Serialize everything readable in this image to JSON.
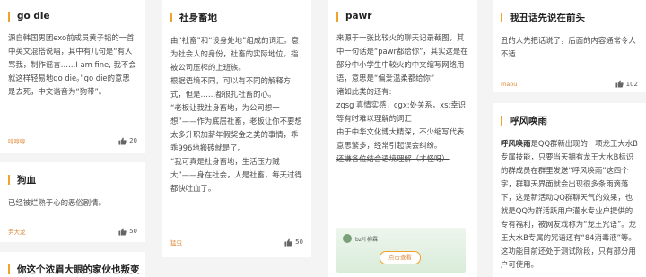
{
  "cards": [
    {
      "title": "go die",
      "paragraphs": [
        "源自韩国男团exo前成员黄子韬的一首中英文混搭说唱，其中有几句是“有人骂我，制作谣言……I am fine, 我不会就这样轻易地go die。”go die的意思是去死，中文谐音为“狗带”。"
      ],
      "author": "哼哼哼",
      "likes": "20"
    },
    {
      "title": "狗血",
      "paragraphs": [
        "已经被烂熟于心的恶俗剧情。"
      ],
      "author": "尹大龙",
      "likes": "50"
    },
    {
      "title": "你这个浓眉大眼的家伙也叛变"
    },
    {
      "title": "社身畜地",
      "paragraphs": [
        "由“社畜”和“设身处地”组成的词汇。意为社会人的身份，社畜的实际地位。指被公司压榨的上班族。",
        "根据语境不同，可以有不同的解释方式，但是……都很扎社畜的心。",
        "“老板让我社身畜地，为公司想一想”——作为底层社畜，老板让你不要想太多升职加薪年假奖金之类的事情，乖乖996地搬砖就是了。",
        "“我可真是社身畜地，生活压力贼大”——身在社会，人是社畜，每天过得都快吐血了。"
      ],
      "author": "猛虫",
      "likes": "50"
    },
    {
      "title": "pawr",
      "paragraphs": [
        "来源于一张比较火的聊天记录截图，其中一句话是“pawr都给你”，其实这是在部分中小学生中较火的中文缩写网络用语，意思是“偏爱温柔都给你”",
        "诸如此类的还有:",
        "zqsg 真情实感，cgx:处关系，xs:幸识",
        "等有时难以理解的词汇",
        "由于中华文化博大精深，不少缩写代表意思繁多，经常引起误会纠纷。"
      ],
      "strike_text": "还嫌各位结合语境理解（才怪呀）",
      "preview_name": "bz叶柳霖",
      "preview_button": "点击查看"
    },
    {
      "title": "我丑话先说在前头",
      "paragraphs": [
        "丑的人先把话说了，后面的内容通常令人不适"
      ],
      "author": "maou",
      "likes": "102"
    },
    {
      "title": "呼风唤雨",
      "lead": "呼风唤雨",
      "paragraphs": [
        "是QQ群新出现的一项龙王大水B专属技能，只要当天拥有龙王大水B标识的群成员在群里发送",
        "“呼风唤雨”这四个字，群聊天界面就会出现很多条雨滴落下，这是新活动QQ群聊天气的效果，也就是QQ为群活跃用户灌水专业户提供的专有福利，被网友戏称为“龙王咒语”。龙王大水B专属的咒语还有“84消毒液”等。这功能目前还处于测试阶段，只有部分用户可使用。"
      ]
    }
  ]
}
